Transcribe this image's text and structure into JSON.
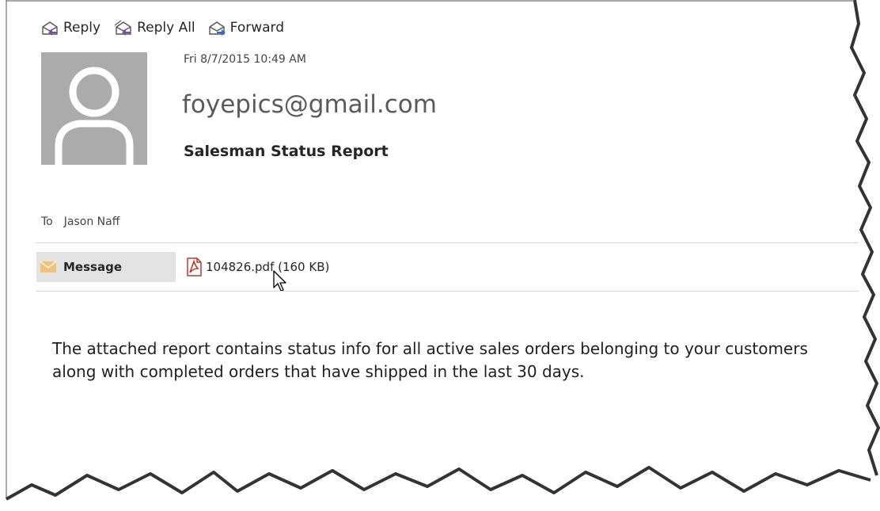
{
  "toolbar": {
    "reply_label": "Reply",
    "reply_all_label": "Reply All",
    "forward_label": "Forward"
  },
  "header": {
    "date": "Fri 8/7/2015 10:49 AM",
    "sender": "foyepics@gmail.com",
    "subject": "Salesman Status Report"
  },
  "recipients": {
    "to_label": "To",
    "to_name": "Jason Naff"
  },
  "tabs": {
    "message_label": "Message"
  },
  "attachment": {
    "name": "104826.pdf (160 KB)"
  },
  "body": {
    "text": "The attached report contains status info for all active sales orders belonging to your customers along with completed orders that have shipped in the last 30 days."
  },
  "colors": {
    "avatar_bg": "#ababab",
    "envelope": "#f2c27a",
    "pdf_red": "#c0392b",
    "reply_arrow": "#7a4bb3",
    "forward_arrow": "#2b6cc4"
  }
}
